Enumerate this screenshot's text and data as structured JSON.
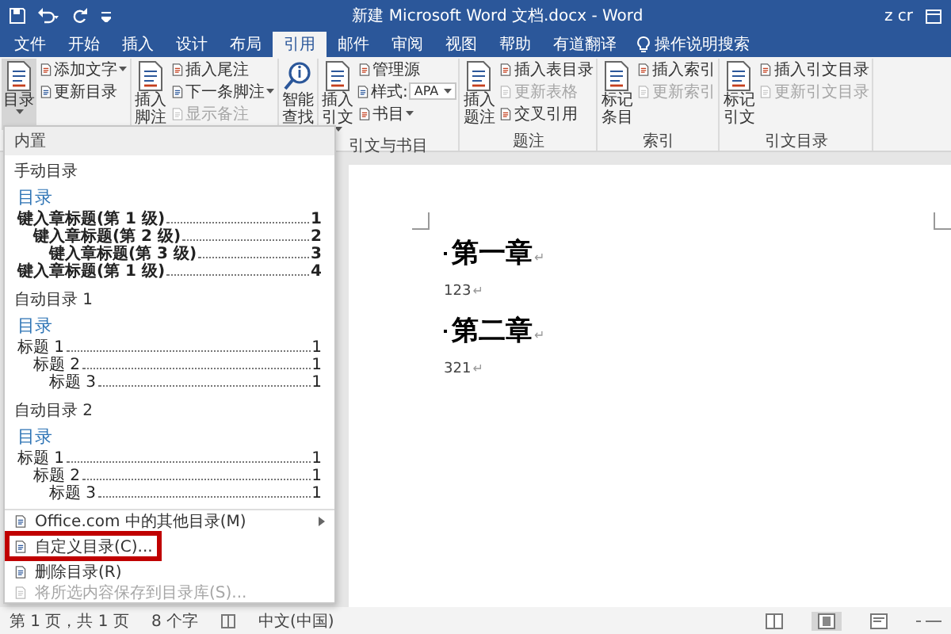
{
  "window": {
    "title": "新建 Microsoft Word 文档.docx - Word",
    "user": "z cr"
  },
  "tabs": [
    {
      "label": "文件",
      "selected": false
    },
    {
      "label": "开始",
      "selected": false
    },
    {
      "label": "插入",
      "selected": false
    },
    {
      "label": "设计",
      "selected": false
    },
    {
      "label": "布局",
      "selected": false
    },
    {
      "label": "引用",
      "selected": true
    },
    {
      "label": "邮件",
      "selected": false
    },
    {
      "label": "审阅",
      "selected": false
    },
    {
      "label": "视图",
      "selected": false
    },
    {
      "label": "帮助",
      "selected": false
    },
    {
      "label": "有道翻译",
      "selected": false
    }
  ],
  "tell_me": "操作说明搜索",
  "ribbon": {
    "groups": [
      {
        "items": [
          {
            "kind": "large",
            "label": "目录",
            "caret": true
          },
          {
            "kind": "small",
            "label": "添加文字",
            "caret": true,
            "disabled": false
          },
          {
            "kind": "small",
            "label": "更新目录",
            "caret": false,
            "disabled": false
          }
        ]
      },
      {
        "items": [
          {
            "kind": "large",
            "label": "插入脚注",
            "caret": false
          },
          {
            "kind": "small",
            "label": "插入尾注",
            "caret": false,
            "disabled": false
          },
          {
            "kind": "small",
            "label": "下一条脚注",
            "caret": true,
            "disabled": false
          },
          {
            "kind": "small",
            "label": "显示备注",
            "caret": false,
            "disabled": true
          }
        ]
      },
      {
        "items": [
          {
            "kind": "large",
            "label": "智能查找",
            "caret": false
          }
        ]
      },
      {
        "label": "引文与书目",
        "items": [
          {
            "kind": "large",
            "label": "插入引文",
            "caret": true
          },
          {
            "kind": "small",
            "label": "管理源",
            "caret": false,
            "disabled": false
          },
          {
            "kind": "select",
            "label": "样式:",
            "value": "APA"
          },
          {
            "kind": "small",
            "label": "书目",
            "caret": true,
            "disabled": false
          }
        ]
      },
      {
        "label": "题注",
        "items": [
          {
            "kind": "large",
            "label": "插入题注",
            "caret": false
          },
          {
            "kind": "small",
            "label": "插入表目录",
            "caret": false,
            "disabled": false
          },
          {
            "kind": "small",
            "label": "更新表格",
            "caret": false,
            "disabled": true
          },
          {
            "kind": "small",
            "label": "交叉引用",
            "caret": false,
            "disabled": false
          }
        ]
      },
      {
        "label": "索引",
        "items": [
          {
            "kind": "large",
            "label": "标记条目",
            "caret": false
          },
          {
            "kind": "small",
            "label": "插入索引",
            "caret": false,
            "disabled": false
          },
          {
            "kind": "small",
            "label": "更新索引",
            "caret": false,
            "disabled": true
          }
        ]
      },
      {
        "label": "引文目录",
        "items": [
          {
            "kind": "large",
            "label": "标记引文",
            "caret": false
          },
          {
            "kind": "small",
            "label": "插入引文目录",
            "caret": false,
            "disabled": false
          },
          {
            "kind": "small",
            "label": "更新引文目录",
            "caret": false,
            "disabled": true
          }
        ]
      }
    ]
  },
  "toc_menu": {
    "header": "内置",
    "gallery": [
      {
        "title": "手动目录",
        "preview": {
          "heading": "目录",
          "bold": true,
          "lines": [
            {
              "text": "键入章标题(第 1 级)",
              "page": "1",
              "children": [
                {
                  "text": "键入章标题(第 2 级)",
                  "page": "2",
                  "children": [
                    {
                      "text": "键入章标题(第 3 级)",
                      "page": "3"
                    }
                  ]
                }
              ]
            },
            {
              "text": "键入章标题(第 1 级)",
              "page": "4"
            }
          ]
        }
      },
      {
        "title": "自动目录 1",
        "preview": {
          "heading": "目录",
          "bold": false,
          "lines": [
            {
              "text": "标题 1",
              "page": "1",
              "children": [
                {
                  "text": "标题 2",
                  "page": "1",
                  "children": [
                    {
                      "text": "标题 3",
                      "page": "1"
                    }
                  ]
                }
              ]
            }
          ]
        }
      },
      {
        "title": "自动目录 2",
        "preview": {
          "heading": "目录",
          "bold": false,
          "lines": [
            {
              "text": "标题 1",
              "page": "1",
              "children": [
                {
                  "text": "标题 2",
                  "page": "1",
                  "children": [
                    {
                      "text": "标题 3",
                      "page": "1"
                    }
                  ]
                }
              ]
            }
          ]
        }
      }
    ],
    "items": [
      {
        "label": "Office.com 中的其他目录(M)",
        "submenu": true,
        "disabled": false,
        "highlighted": false
      },
      {
        "label": "自定义目录(C)...",
        "submenu": false,
        "disabled": false,
        "highlighted": true
      },
      {
        "label": "删除目录(R)",
        "submenu": false,
        "disabled": false,
        "highlighted": false
      },
      {
        "label": "将所选内容保存到目录库(S)...",
        "submenu": false,
        "disabled": true,
        "highlighted": false
      }
    ]
  },
  "document": {
    "paragraphs": [
      {
        "kind": "heading",
        "text": "第一章",
        "mark": "↵"
      },
      {
        "kind": "body",
        "text": "123",
        "mark": "↵"
      },
      {
        "kind": "heading",
        "text": "第二章",
        "mark": "↵"
      },
      {
        "kind": "body",
        "text": "321",
        "mark": "↵"
      }
    ]
  },
  "status_bar": {
    "items": [
      "第 1 页，共 1 页",
      "8 个字",
      "中文(中国)"
    ],
    "views": [
      {
        "selected": false
      },
      {
        "selected": true
      },
      {
        "selected": false
      }
    ]
  }
}
